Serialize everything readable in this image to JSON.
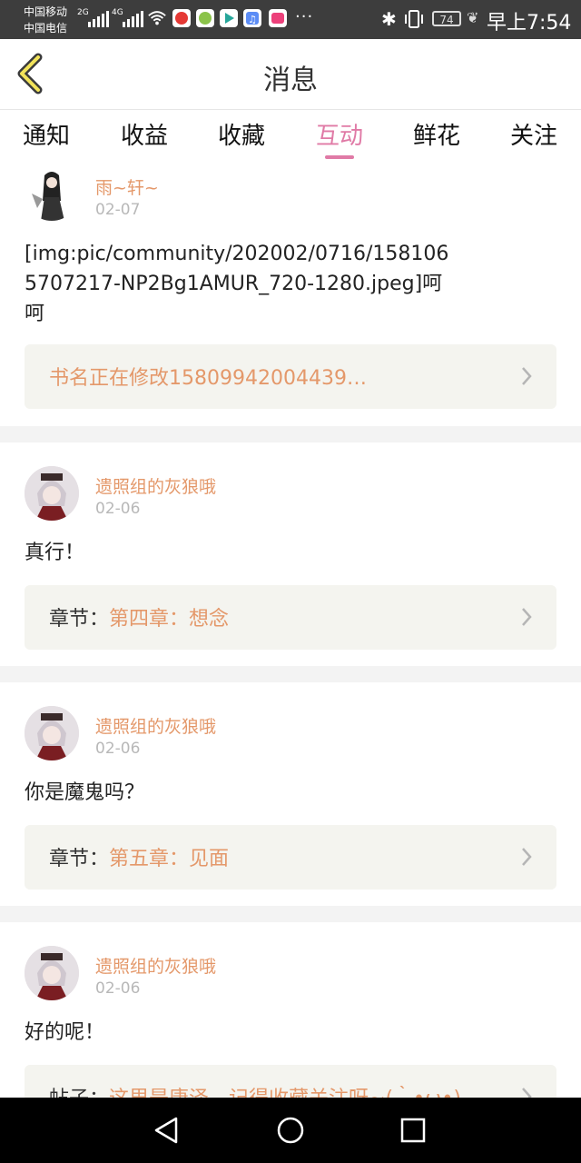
{
  "status_bar": {
    "carrier1": "中国移动",
    "carrier2": "中国电信",
    "signal1_type": "2G",
    "signal2_type": "4G",
    "battery": "74",
    "time": "早上7:54"
  },
  "header": {
    "title": "消息",
    "back_icon": "chevron-left-icon"
  },
  "tabs": [
    {
      "label": "通知",
      "active": false
    },
    {
      "label": "收益",
      "active": false
    },
    {
      "label": "收藏",
      "active": false
    },
    {
      "label": "互动",
      "active": true
    },
    {
      "label": "鲜花",
      "active": false
    },
    {
      "label": "关注",
      "active": false
    }
  ],
  "colors": {
    "accent_pink": "#e07aa6",
    "name_orange": "#e4986a",
    "box_bg": "#f4f4ef"
  },
  "messages": [
    {
      "username": "雨~轩~",
      "date": "02-07",
      "content": "[img:pic/community/202002/0716/1581065707217-NP2Bg1AMUR_720-1280.jpeg]呵呵",
      "link_prefix": "",
      "link_text": "书名正在修改15809942004439…"
    },
    {
      "username": "遗照组的灰狼哦",
      "date": "02-06",
      "content": "真行！",
      "link_prefix": "章节：",
      "link_text": "第四章：想念"
    },
    {
      "username": "遗照组的灰狼哦",
      "date": "02-06",
      "content": "你是魔鬼吗？",
      "link_prefix": "章节：",
      "link_text": "第五章：见面"
    },
    {
      "username": "遗照组的灰狼哦",
      "date": "02-06",
      "content": "好的呢！",
      "link_prefix": "帖子：",
      "link_text": "这里是唐泽，记得收藏关注呀~(｀•ω•)"
    }
  ],
  "nav": {
    "back": "triangle-back-icon",
    "home": "circle-home-icon",
    "recents": "square-recents-icon"
  }
}
